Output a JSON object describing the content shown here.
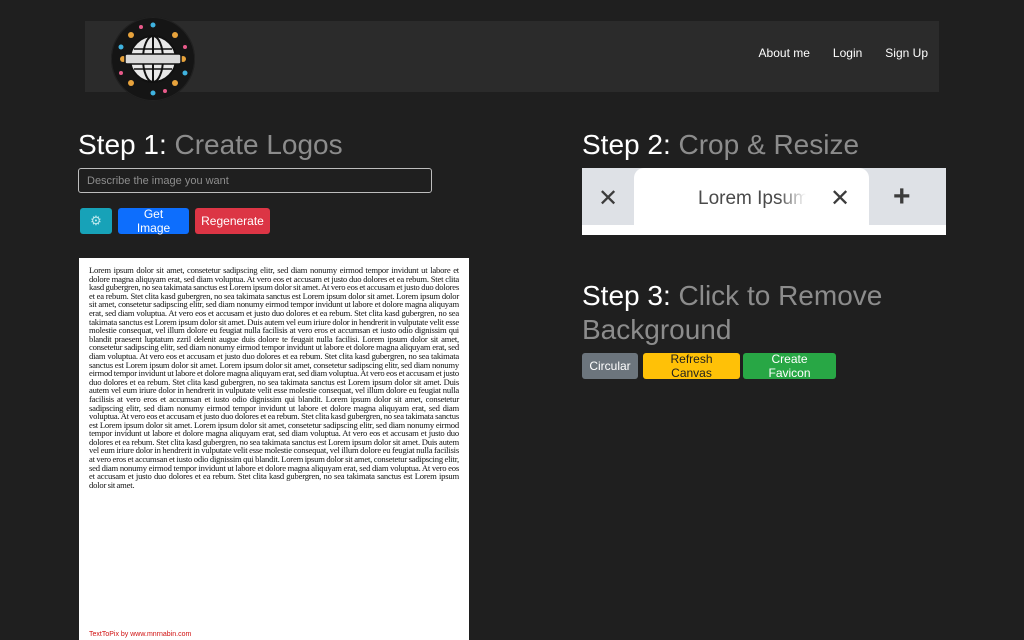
{
  "nav": {
    "links": [
      "About me",
      "Login",
      "Sign Up"
    ]
  },
  "step1": {
    "prefix": "Step 1:",
    "title": "Create Logos",
    "input_placeholder": "Describe the image you want",
    "input_value": "",
    "buttons": {
      "settings_icon": "gear-icon",
      "get_image": "Get Image",
      "regenerate": "Regenerate"
    },
    "canvas": {
      "text": "Lorem ipsum dolor sit amet, consetetur sadipscing elitr, sed diam nonumy eirmod tempor invidunt ut labore et dolore magna aliquyam erat, sed diam voluptua. At vero eos et accusam et justo duo dolores et ea rebum. Stet clita kasd gubergren, no sea takimata sanctus est Lorem ipsum dolor sit amet. At vero eos et accusam et justo duo dolores et ea rebum. Stet clita kasd gubergren, no sea takimata sanctus est Lorem ipsum dolor sit amet. Lorem ipsum dolor sit amet, consetetur sadipscing elitr, sed diam nonumy eirmod tempor invidunt ut labore et dolore magna aliquyam erat, sed diam voluptua. At vero eos et accusam et justo duo dolores et ea rebum. Stet clita kasd gubergren, no sea takimata sanctus est Lorem ipsum dolor sit amet. Duis autem vel eum iriure dolor in hendrerit in vulputate velit esse molestie consequat, vel illum dolore eu feugiat nulla facilisis at vero eros et accumsan et iusto odio dignissim qui blandit praesent luptatum zzril delenit augue duis dolore te feugait nulla facilisi. Lorem ipsum dolor sit amet, consetetur sadipscing elitr, sed diam nonumy eirmod tempor invidunt ut labore et dolore magna aliquyam erat, sed diam voluptua. At vero eos et accusam et justo duo dolores et ea rebum. Stet clita kasd gubergren, no sea takimata sanctus est Lorem ipsum dolor sit amet. Lorem ipsum dolor sit amet, consetetur sadipscing elitr, sed diam nonumy eirmod tempor invidunt ut labore et dolore magna aliquyam erat, sed diam voluptua. At vero eos et accusam et justo duo dolores et ea rebum. Stet clita kasd gubergren, no sea takimata sanctus est Lorem ipsum dolor sit amet. Duis autem vel eum iriure dolor in hendrerit in vulputate velit esse molestie consequat, vel illum dolore eu feugiat nulla facilisis at vero eros et accumsan et iusto odio dignissim qui blandit. Lorem ipsum dolor sit amet, consetetur sadipscing elitr, sed diam nonumy eirmod tempor invidunt ut labore et dolore magna aliquyam erat, sed diam voluptua. At vero eos et accusam et justo duo dolores et ea rebum. Stet clita kasd gubergren, no sea takimata sanctus est Lorem ipsum dolor sit amet. Lorem ipsum dolor sit amet, consetetur sadipscing elitr, sed diam nonumy eirmod tempor invidunt ut labore et dolore magna aliquyam erat, sed diam voluptua. At vero eos et accusam et justo duo dolores et ea rebum. Stet clita kasd gubergren, no sea takimata sanctus est Lorem ipsum dolor sit amet. Duis autem vel eum iriure dolor in hendrerit in vulputate velit esse molestie consequat, vel illum dolore eu feugiat nulla facilisis at vero eros et accumsan et iusto odio dignissim qui blandit. Lorem ipsum dolor sit amet, consetetur sadipscing elitr, sed diam nonumy eirmod tempor invidunt ut labore et dolore magna aliquyam erat, sed diam voluptua. At vero eos et accusam et justo duo dolores et ea rebum. Stet clita kasd gubergren, no sea takimata sanctus est Lorem ipsum dolor sit amet.",
      "watermark": "TextToPix by www.mnrnabin.com"
    }
  },
  "step2": {
    "prefix": "Step 2:",
    "title": "Crop & Resize",
    "tab_preview": {
      "tab_title": "Lorem Ipsum",
      "close_symbol": "✕",
      "new_tab_symbol": "+"
    }
  },
  "step3": {
    "prefix": "Step 3:",
    "title": "Click to Remove Background",
    "buttons": {
      "circular": "Circular",
      "refresh": "Refresh Canvas",
      "favicon": "Create Favicon"
    }
  },
  "colors": {
    "page_bg": "#1f1f1f",
    "navbar_bg": "#2b2b2b",
    "muted_title": "#8c8c8c",
    "info": "#17a2b8",
    "primary": "#0d6efd",
    "danger": "#dc3545",
    "secondary": "#6c757d",
    "warning": "#ffc107",
    "success": "#28a745"
  }
}
